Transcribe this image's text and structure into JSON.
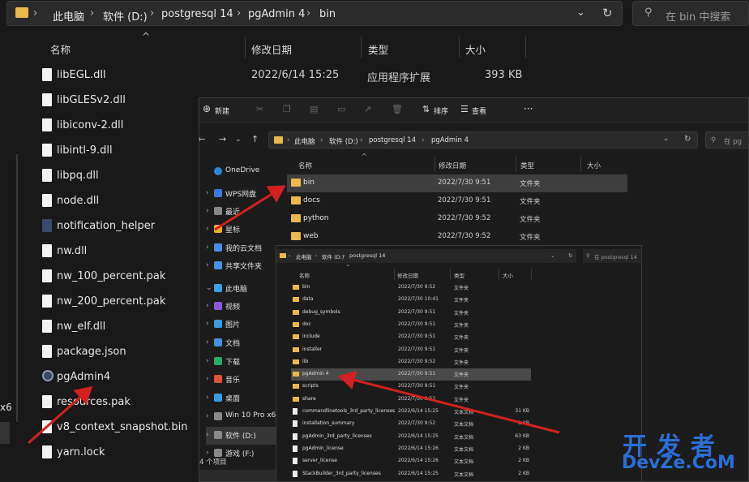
{
  "back_window": {
    "breadcrumbs": [
      "此电脑",
      "软件 (D:)",
      "postgresql 14",
      "pgAdmin 4",
      "bin"
    ],
    "search_placeholder": "在 bin 中搜索",
    "columns": [
      "名称",
      "修改日期",
      "类型",
      "大小"
    ],
    "first_row": {
      "name": "libEGL.dll",
      "date": "2022/6/14 15:25",
      "type": "应用程序扩展",
      "size": "393 KB"
    },
    "files": [
      "libGLESv2.dll",
      "libiconv-2.dll",
      "libintl-9.dll",
      "libpq.dll",
      "node.dll",
      "notification_helper",
      "nw.dll",
      "nw_100_percent.pak",
      "nw_200_percent.pak",
      "nw_elf.dll",
      "package.json",
      "pgAdmin4",
      "resources.pak",
      "v8_context_snapshot.bin",
      "yarn.lock"
    ],
    "left_edge_text": "x6"
  },
  "mid_window": {
    "toolbar": {
      "new_label": "新建",
      "sort_label": "排序",
      "view_label": "查看",
      "more": "···"
    },
    "breadcrumbs": [
      "此电脑",
      "软件 (D:)",
      "postgresql 14",
      "pgAdmin 4"
    ],
    "search_placeholder": "在 pg",
    "columns": [
      "名称",
      "修改日期",
      "类型",
      "大小"
    ],
    "rows": [
      {
        "name": "bin",
        "date": "2022/7/30 9:51",
        "type": "文件夹"
      },
      {
        "name": "docs",
        "date": "2022/7/30 9:51",
        "type": "文件夹"
      },
      {
        "name": "python",
        "date": "2022/7/30 9:52",
        "type": "文件夹"
      },
      {
        "name": "web",
        "date": "2022/7/30 9:52",
        "type": "文件夹"
      }
    ],
    "sidebar": [
      {
        "label": "OneDrive",
        "color": "#2b88d8"
      },
      {
        "label": "WPS网盘",
        "color": "#3a7bd5"
      },
      {
        "label": "最近",
        "color": "#888888"
      },
      {
        "label": "星标",
        "color": "#e8b01f"
      },
      {
        "label": "我的云文档",
        "color": "#4a8fe0"
      },
      {
        "label": "共享文件夹",
        "color": "#4a8fe0"
      },
      {
        "label": "此电脑",
        "color": "#3aa0e8"
      },
      {
        "label": "视频",
        "color": "#8c5ad8"
      },
      {
        "label": "图片",
        "color": "#3a9be0"
      },
      {
        "label": "文档",
        "color": "#4a8fe0"
      },
      {
        "label": "下载",
        "color": "#2fa86a"
      },
      {
        "label": "音乐",
        "color": "#e0503a"
      },
      {
        "label": "桌面",
        "color": "#3a9be0"
      },
      {
        "label": "Win 10 Pro x6",
        "color": "#8a8a8a"
      },
      {
        "label": "软件 (D:)",
        "color": "#8a8a8a"
      },
      {
        "label": "游戏 (F:)",
        "color": "#8a8a8a"
      }
    ],
    "status": "4 个项目"
  },
  "front_window": {
    "breadcrumbs": [
      "此电脑",
      "软件 (D:)",
      "postgresql 14"
    ],
    "search_placeholder": "在 postgresql 14",
    "columns": [
      "名称",
      "修改日期",
      "类型",
      "大小"
    ],
    "rows": [
      {
        "name": "bin",
        "date": "2022/7/30 9:52",
        "type": "文件夹",
        "size": "",
        "kind": "folder"
      },
      {
        "name": "data",
        "date": "2022/7/30 10:41",
        "type": "文件夹",
        "size": "",
        "kind": "folder"
      },
      {
        "name": "debug_symbols",
        "date": "2022/7/30 9:51",
        "type": "文件夹",
        "size": "",
        "kind": "folder"
      },
      {
        "name": "doc",
        "date": "2022/7/30 9:51",
        "type": "文件夹",
        "size": "",
        "kind": "folder"
      },
      {
        "name": "include",
        "date": "2022/7/30 9:51",
        "type": "文件夹",
        "size": "",
        "kind": "folder"
      },
      {
        "name": "installer",
        "date": "2022/7/30 9:51",
        "type": "文件夹",
        "size": "",
        "kind": "folder"
      },
      {
        "name": "lib",
        "date": "2022/7/30 9:52",
        "type": "文件夹",
        "size": "",
        "kind": "folder"
      },
      {
        "name": "pgAdmin 4",
        "date": "2022/7/30 9:51",
        "type": "文件夹",
        "size": "",
        "kind": "folder"
      },
      {
        "name": "scripts",
        "date": "2022/7/30 9:51",
        "type": "文件夹",
        "size": "",
        "kind": "folder"
      },
      {
        "name": "share",
        "date": "2022/7/30 9:52",
        "type": "文件夹",
        "size": "",
        "kind": "folder"
      },
      {
        "name": "commandlinetools_3rd_party_licenses",
        "date": "2022/6/14 15:25",
        "type": "文本文档",
        "size": "31 KB",
        "kind": "doc"
      },
      {
        "name": "installation_summary",
        "date": "2022/7/30 9:52",
        "type": "文本文档",
        "size": "1 KB",
        "kind": "doc"
      },
      {
        "name": "pgAdmin_3rd_party_licenses",
        "date": "2022/6/14 15:25",
        "type": "文本文档",
        "size": "63 KB",
        "kind": "doc"
      },
      {
        "name": "pgAdmin_license",
        "date": "2022/6/14 15:26",
        "type": "文本文档",
        "size": "2 KB",
        "kind": "doc"
      },
      {
        "name": "server_license",
        "date": "2022/6/14 15:26",
        "type": "文本文档",
        "size": "2 KB",
        "kind": "doc"
      },
      {
        "name": "StackBuilder_3rd_party_licenses",
        "date": "2022/6/14 15:25",
        "type": "文本文档",
        "size": "2 KB",
        "kind": "doc"
      }
    ]
  },
  "watermark": {
    "line1": "开发者",
    "line2": "DevZe.CoM"
  },
  "colors": {
    "accent_arrow": "#d42020",
    "folder": "#e9b94b",
    "watermark": "#2a6fd6"
  }
}
